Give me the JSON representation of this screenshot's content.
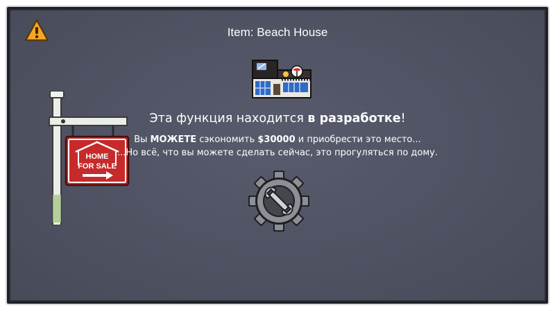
{
  "dialog": {
    "title": "Item: Beach House",
    "headline_prefix": "Эта функция находится ",
    "headline_bold": "в разработке",
    "headline_suffix": "!",
    "line1_prefix": "Вы ",
    "line1_bold": "МОЖЕТЕ",
    "line1_mid": " сэкономить ",
    "line1_price": "$30000",
    "line1_suffix": " и приобрести это место...",
    "line2": "...Но всё, что вы можете сделать сейчас, это прогуляться по дому."
  },
  "sign": {
    "line1": "HOME",
    "line2": "FOR SALE"
  },
  "icons": {
    "warning": "warning-icon",
    "house": "beach-house-icon",
    "sign": "home-for-sale-sign",
    "gear": "wrench-gear-icon"
  },
  "colors": {
    "panel": "#4f5262",
    "sign_red": "#c62a2a",
    "warning": "#f5a623"
  }
}
